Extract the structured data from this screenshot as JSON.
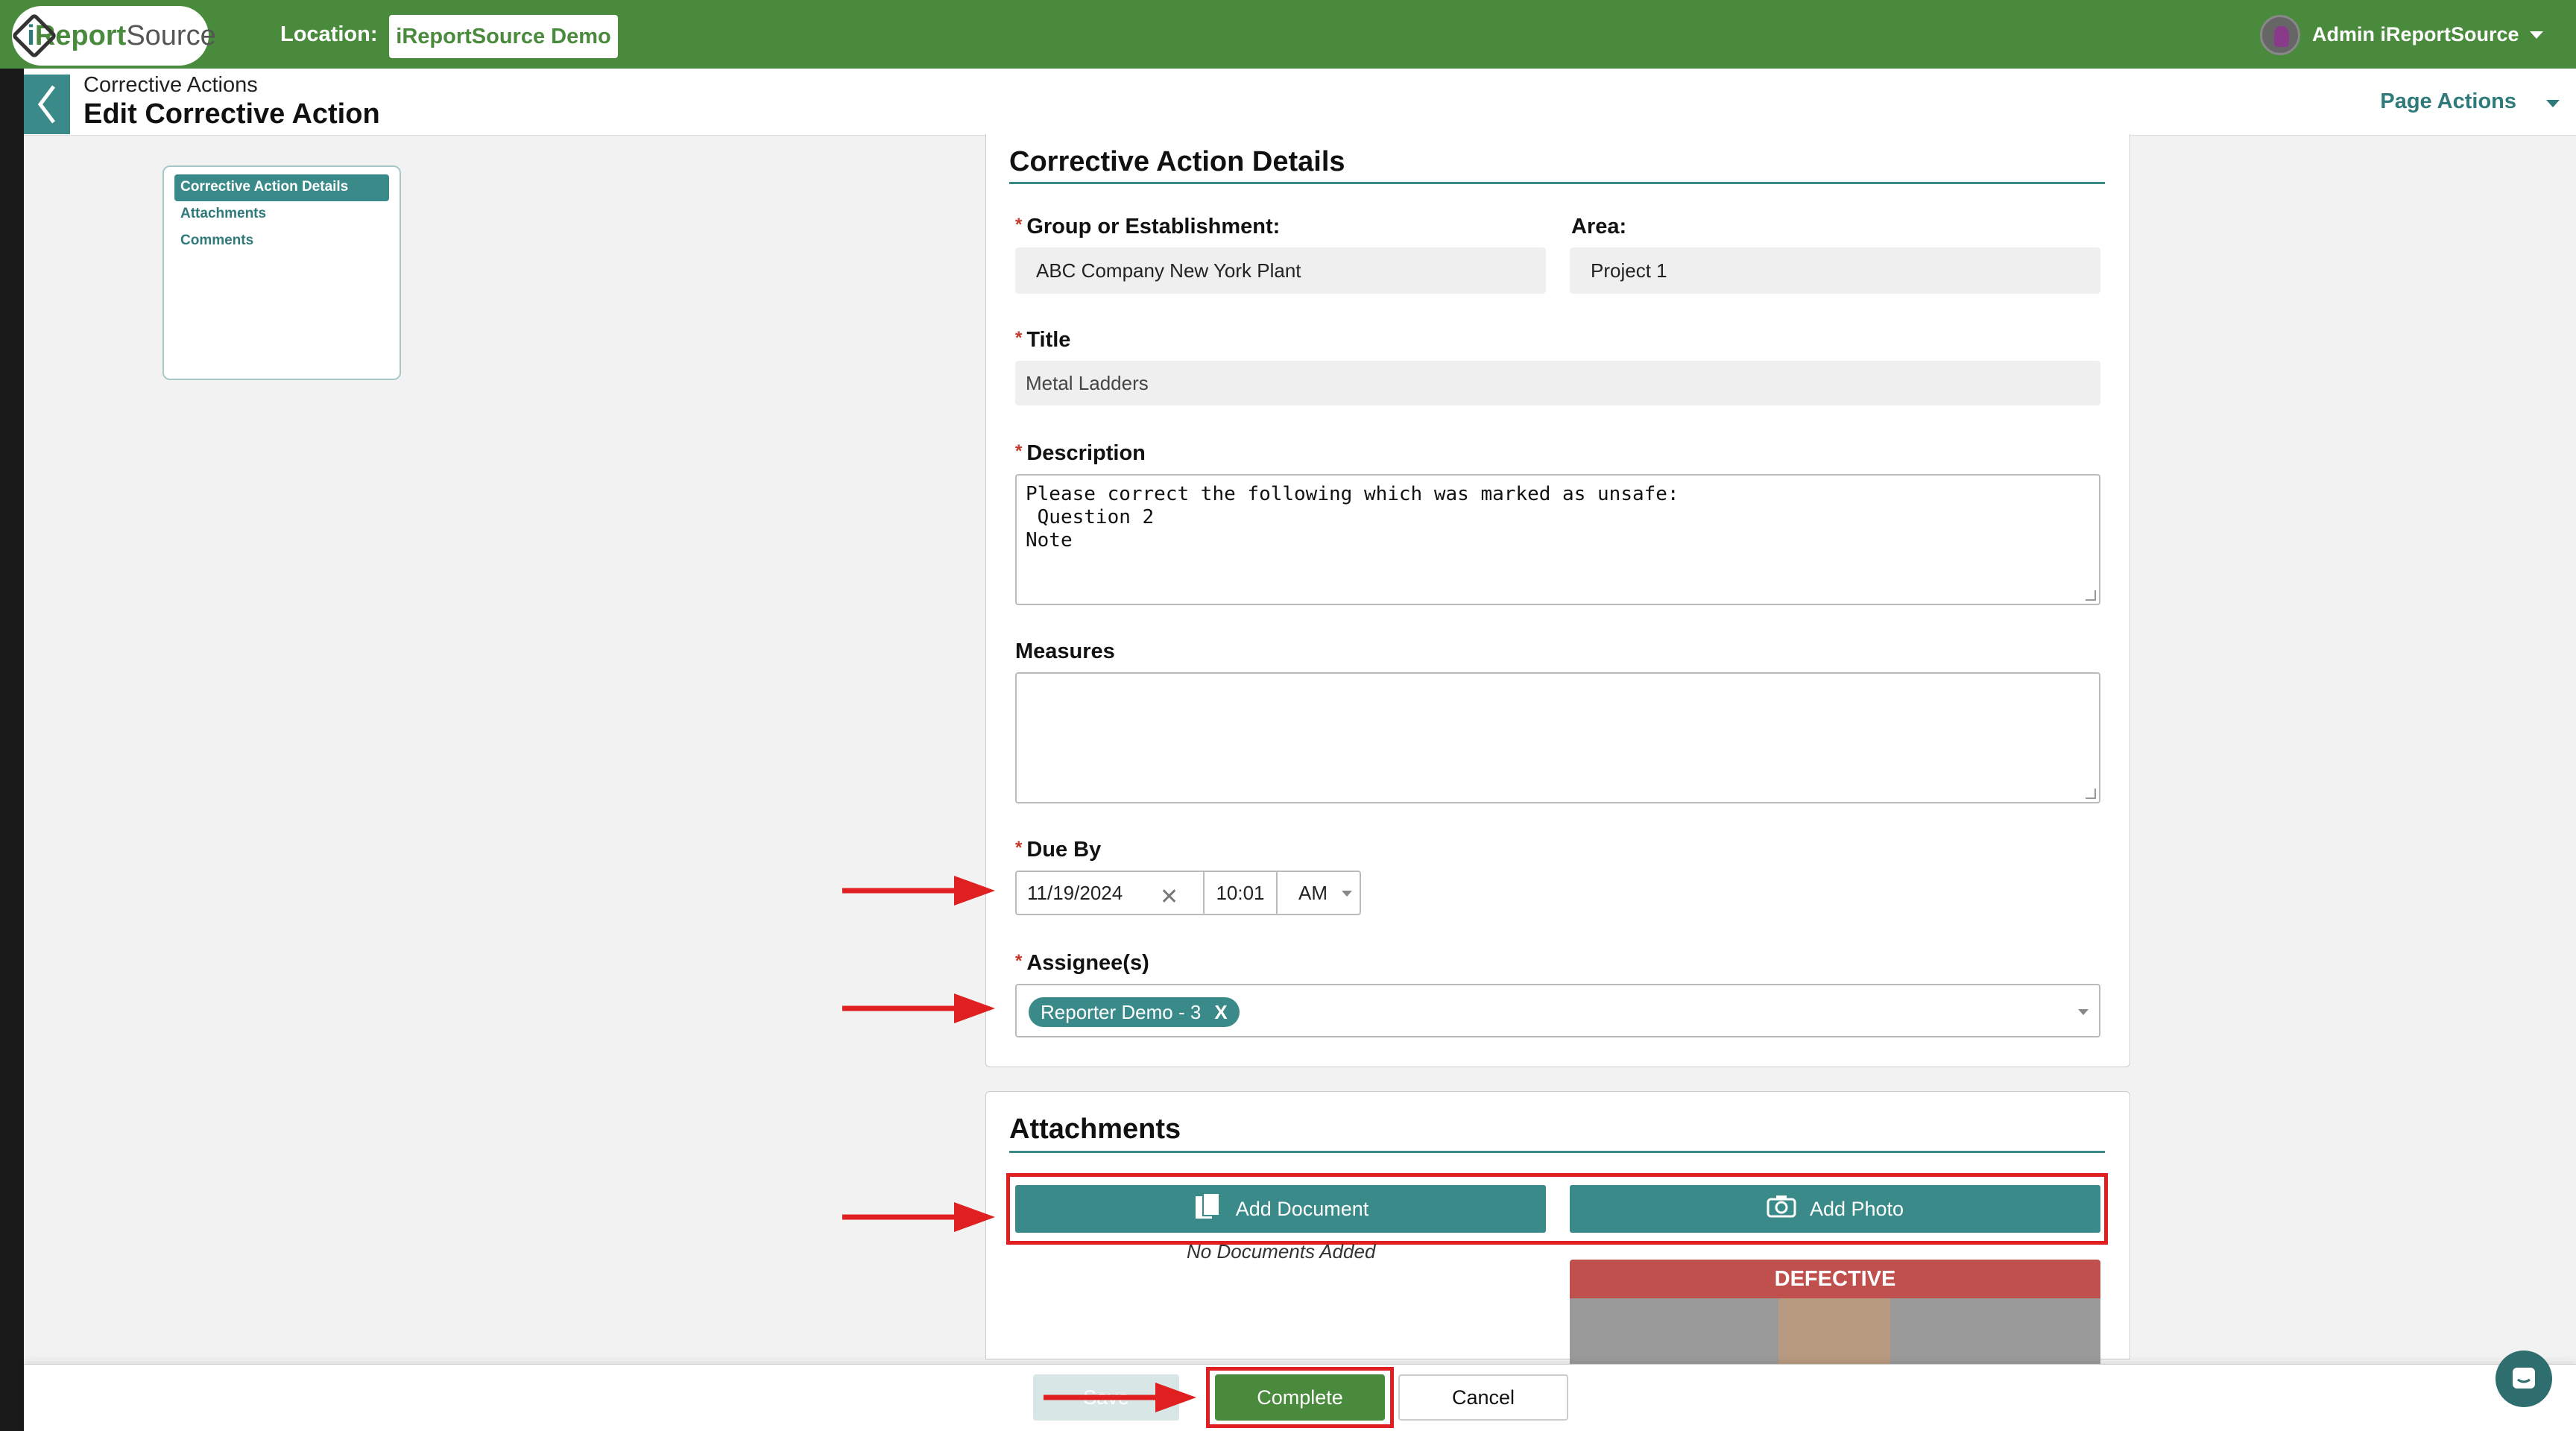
{
  "app": {
    "logo_text_i": "i",
    "logo_text_report": "Report",
    "logo_text_source": "Source",
    "location_label": "Location:",
    "location_value": "iReportSource Demo",
    "user_name": "Admin iReportSource"
  },
  "header": {
    "breadcrumb": "Corrective Actions",
    "title": "Edit Corrective Action",
    "page_actions": "Page Actions"
  },
  "sidenav": {
    "items": [
      {
        "label": "Corrective Action Details",
        "active": true
      },
      {
        "label": "Attachments",
        "active": false
      },
      {
        "label": "Comments",
        "active": false
      }
    ]
  },
  "details": {
    "heading": "Corrective Action Details",
    "group_label": "Group or Establishment:",
    "group_value": "ABC Company New York Plant",
    "area_label": "Area:",
    "area_value": "Project 1",
    "title_label": "Title",
    "title_value": "Metal Ladders",
    "description_label": "Description",
    "description_value": "Please correct the following which was marked as unsafe:\n Question 2\nNote",
    "measures_label": "Measures",
    "measures_value": "",
    "due_label": "Due By",
    "due_date": "11/19/2024",
    "due_time": "10:01",
    "due_ampm": "AM",
    "assignee_label": "Assignee(s)",
    "assignee_tag": "Reporter Demo - 3",
    "assignee_tag_remove": "X"
  },
  "attachments": {
    "heading": "Attachments",
    "add_document": "Add Document",
    "add_photo": "Add Photo",
    "no_documents": "No Documents Added",
    "photo_label": "DEFECTIVE"
  },
  "footer": {
    "save": "Save",
    "complete": "Complete",
    "cancel": "Cancel"
  },
  "colors": {
    "brand_green": "#4a8a3c",
    "teal": "#3a8a8a",
    "annotation_red": "#e02020",
    "defective_red": "#c0504d"
  }
}
